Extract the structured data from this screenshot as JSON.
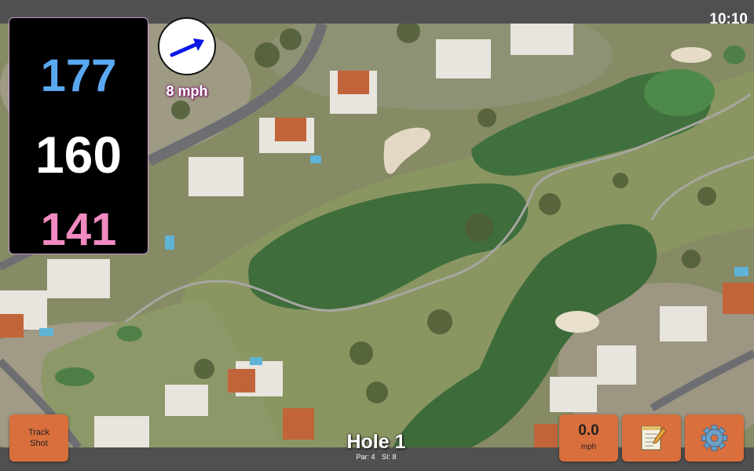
{
  "status": {
    "time": "10:10"
  },
  "distances": {
    "back": "177",
    "middle": "160",
    "front": "141"
  },
  "wind": {
    "speed_label": "8 mph",
    "icon": "wind-direction-arrow-icon"
  },
  "buttons": {
    "track_shot_line1": "Track",
    "track_shot_line2": "Shot",
    "speed_value": "0.0",
    "speed_unit": "mph",
    "notes_icon": "notepad-icon",
    "settings_icon": "gear-icon"
  },
  "hole": {
    "title": "Hole 1",
    "par_label": "Par: 4",
    "si_label": "SI: 8"
  },
  "colors": {
    "back_distance": "#5aa8f0",
    "middle_distance": "#ffffff",
    "front_distance": "#f08ac0",
    "button_orange": "#d96f3c",
    "fairway": "#3f6d3c"
  }
}
